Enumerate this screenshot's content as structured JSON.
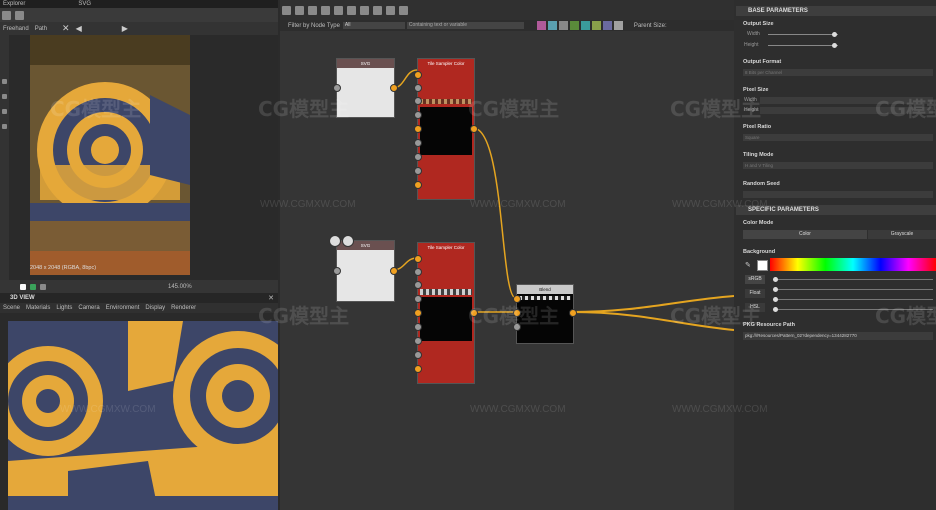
{
  "explorer": {
    "tab_label": "Explorer",
    "tab2_label": "SVG"
  },
  "image_viewer": {
    "tools": [
      "Freehand",
      "Path"
    ],
    "status": "2048 x 2048 (RGBA, 8bpc)",
    "zoom": "145.00%"
  },
  "view3d": {
    "title": "3D VIEW",
    "menu": [
      "Scene",
      "Materials",
      "Lights",
      "Camera",
      "Environment",
      "Display",
      "Renderer"
    ]
  },
  "graph": {
    "filter_label": "Filter by Node Type",
    "filter_value": "All",
    "containing_placeholder": "Containing text or variable",
    "parent_size_label": "Parent Size:",
    "nodes": [
      {
        "title": "SVG"
      },
      {
        "title": "Tile Sampler Color"
      },
      {
        "title": "SVG"
      },
      {
        "title": "Tile Sampler Color"
      },
      {
        "title": "Blend"
      }
    ]
  },
  "params": {
    "base_header": "BASE PARAMETERS",
    "output_size": "Output Size",
    "width": "Width",
    "height": "Height",
    "output_format": "Output Format",
    "output_format_value": "8 Bits per Channel",
    "pixel_size": "Pixel Size",
    "pixel_width": "Width",
    "pixel_height": "Height",
    "pixel_ratio": "Pixel Ratio",
    "pixel_ratio_value": "Square",
    "tiling_mode": "Tiling Mode",
    "tiling_mode_value": "H and V Tiling",
    "random_seed": "Random Seed",
    "specific_header": "SPECIFIC PARAMETERS",
    "color_mode": "Color Mode",
    "color_option": "Color",
    "grayscale_option": "Grayscale",
    "background": "Background",
    "srgb": "sRGB",
    "float": "Float",
    "hsl": "HSL",
    "pkg_label": "PKG Resource Path",
    "pkg_value": "pkg:///Resources/Pattern_02?dependency=1344282770"
  },
  "watermark": {
    "logo": "CG模型主",
    "url": "WWW.CGMXW.COM"
  }
}
